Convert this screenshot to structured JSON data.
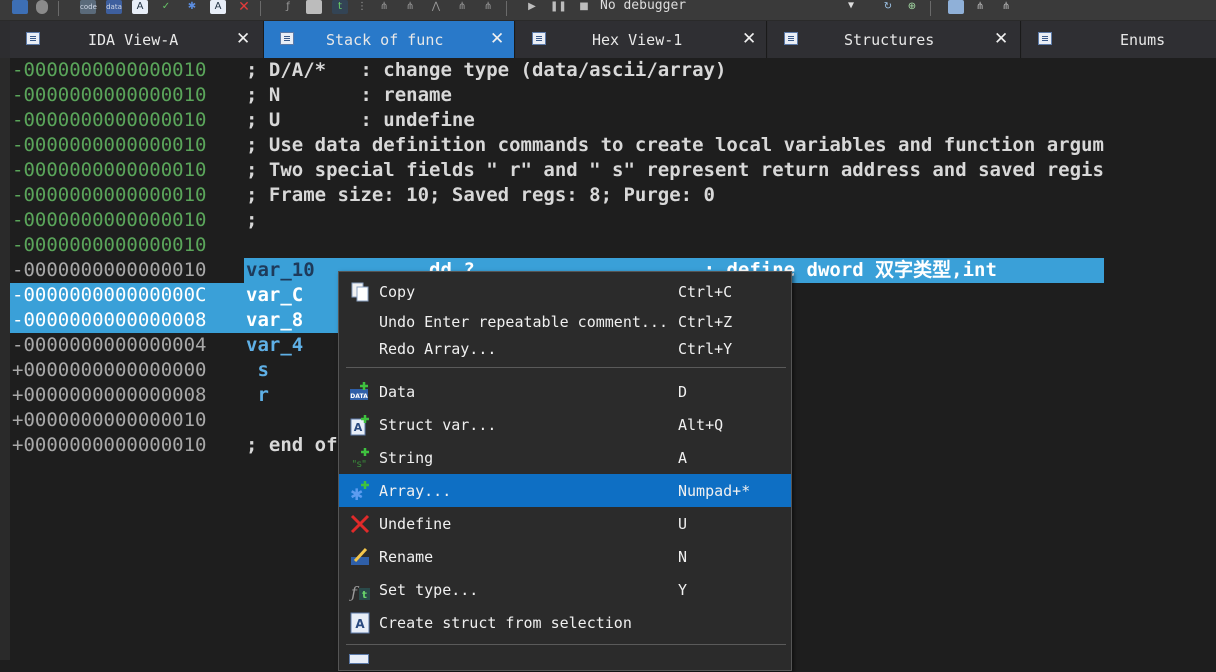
{
  "toolbar": {
    "debugger_label": "No debugger"
  },
  "tabs": [
    {
      "label": "IDA View-A"
    },
    {
      "label": "Stack of func"
    },
    {
      "label": "Hex View-1"
    },
    {
      "label": "Structures"
    },
    {
      "label": "Enums"
    }
  ],
  "listing": {
    "lines": [
      {
        "addr": "-0000000000000010",
        "code": "; D/A/*   : change type (data/ascii/array)"
      },
      {
        "addr": "-0000000000000010",
        "code": "; N       : rename"
      },
      {
        "addr": "-0000000000000010",
        "code": "; U       : undefine"
      },
      {
        "addr": "-0000000000000010",
        "code": "; Use data definition commands to create local variables and function argum"
      },
      {
        "addr": "-0000000000000010",
        "code": "; Two special fields \" r\" and \" s\" represent return address and saved regis"
      },
      {
        "addr": "-0000000000000010",
        "code": "; Frame size: 10; Saved regs: 8; Purge: 0"
      },
      {
        "addr": "-0000000000000010",
        "code": ";"
      },
      {
        "addr": "-0000000000000010",
        "code": ""
      },
      {
        "addr": "-0000000000000010",
        "name": "var_10",
        "rest": "          dd ?                    ; define dword 双字类型,int"
      },
      {
        "addr": "-000000000000000C",
        "name": "var_C",
        "rest": ""
      },
      {
        "addr": "-0000000000000008",
        "name": "var_8",
        "rest": ""
      },
      {
        "addr": "-0000000000000004",
        "name": "var_4",
        "rest": ""
      },
      {
        "addr": "+0000000000000000",
        "name": " s",
        "rest": ""
      },
      {
        "addr": "+0000000000000008",
        "name": " r",
        "rest": ""
      },
      {
        "addr": "+0000000000000010",
        "code": ""
      },
      {
        "addr": "+0000000000000010",
        "code": "; end of"
      }
    ]
  },
  "context_menu": {
    "items": [
      {
        "label": "Copy",
        "shortcut": "Ctrl+C",
        "icon": "copy-icon"
      },
      {
        "label": "Undo Enter repeatable comment...",
        "shortcut": "Ctrl+Z",
        "icon": ""
      },
      {
        "label": "Redo Array...",
        "shortcut": "Ctrl+Y",
        "icon": ""
      },
      {
        "label": "Data",
        "shortcut": "D",
        "icon": "data-icon"
      },
      {
        "label": "Struct var...",
        "shortcut": "Alt+Q",
        "icon": "struct-var-icon"
      },
      {
        "label": "String",
        "shortcut": "A",
        "icon": "string-icon"
      },
      {
        "label": "Array...",
        "shortcut": "Numpad+*",
        "icon": "array-icon"
      },
      {
        "label": "Undefine",
        "shortcut": "U",
        "icon": "undefine-icon"
      },
      {
        "label": "Rename",
        "shortcut": "N",
        "icon": "rename-icon"
      },
      {
        "label": "Set type...",
        "shortcut": "Y",
        "icon": "set-type-icon"
      },
      {
        "label": "Create struct from selection",
        "shortcut": "",
        "icon": "create-struct-icon"
      }
    ]
  },
  "colors": {
    "selection": "#3aa0d8",
    "menu_highlight": "#0e6fc4",
    "active_tab": "#2979c9",
    "address_green": "#5aa55a"
  }
}
